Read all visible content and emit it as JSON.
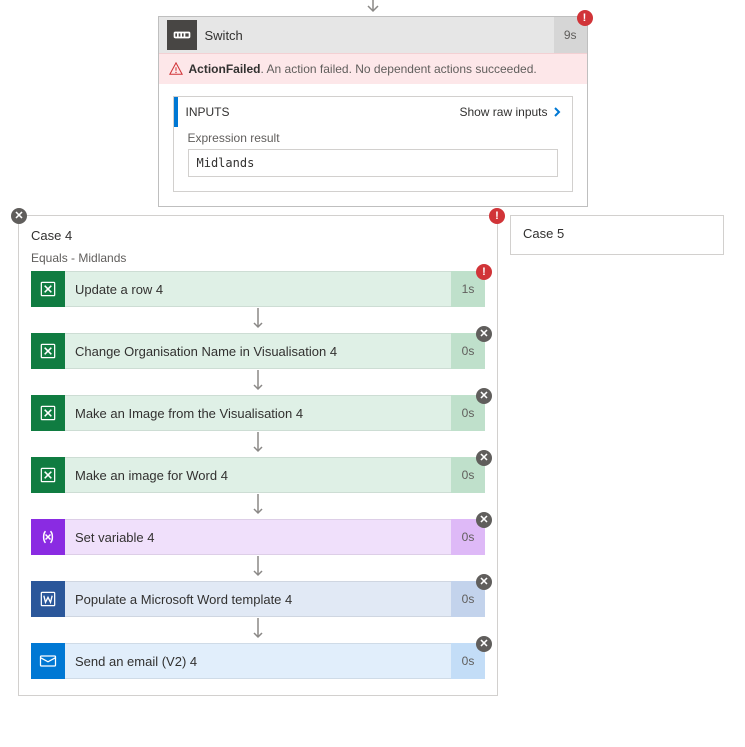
{
  "top_arrow": true,
  "switch": {
    "title": "Switch",
    "duration": "9s",
    "error": {
      "title": "ActionFailed",
      "message": ". An action failed. No dependent actions succeeded."
    },
    "inputs": {
      "section_label": "INPUTS",
      "link_label": "Show raw inputs",
      "expression_label": "Expression result",
      "expression_value": "Midlands"
    }
  },
  "case4": {
    "title": "Case 4",
    "condition": "Equals - Midlands",
    "actions": [
      {
        "type": "excel",
        "label": "Update a row 4",
        "duration": "1s",
        "status": "error"
      },
      {
        "type": "excel",
        "label": "Change Organisation Name in Visualisation 4",
        "duration": "0s",
        "status": "skip"
      },
      {
        "type": "excel",
        "label": "Make an Image from the Visualisation 4",
        "duration": "0s",
        "status": "skip"
      },
      {
        "type": "excel",
        "label": "Make an image for Word 4",
        "duration": "0s",
        "status": "skip"
      },
      {
        "type": "var",
        "label": "Set variable 4",
        "duration": "0s",
        "status": "skip"
      },
      {
        "type": "word",
        "label": "Populate a Microsoft Word template 4",
        "duration": "0s",
        "status": "skip"
      },
      {
        "type": "outlook",
        "label": "Send an email (V2) 4",
        "duration": "0s",
        "status": "skip"
      }
    ]
  },
  "case5": {
    "title": "Case 5"
  }
}
